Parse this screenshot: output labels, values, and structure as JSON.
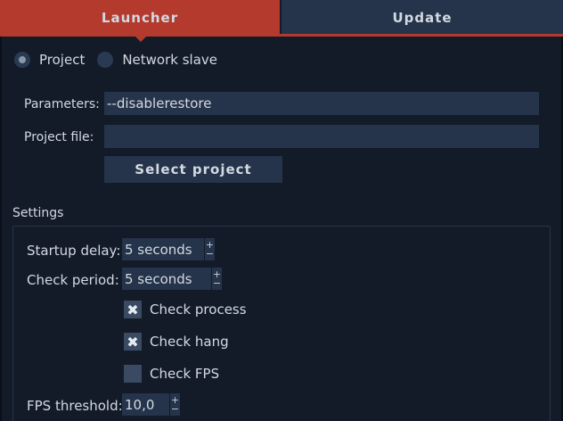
{
  "tabs": {
    "launcher": "Launcher",
    "update": "Update"
  },
  "mode": {
    "project_label": "Project",
    "network_slave_label": "Network slave",
    "selected": "Project"
  },
  "parameters": {
    "label": "Parameters:",
    "value": "--disablerestore"
  },
  "project_file": {
    "label": "Project file:",
    "value": ""
  },
  "select_project_label": "Select project",
  "settings": {
    "title": "Settings",
    "startup_delay": {
      "label": "Startup delay:",
      "value": "5 seconds"
    },
    "check_period": {
      "label": "Check period:",
      "value": "5 seconds"
    },
    "check_process": {
      "label": "Check process",
      "checked": true
    },
    "check_hang": {
      "label": "Check hang",
      "checked": true
    },
    "check_fps": {
      "label": "Check FPS",
      "checked": false
    },
    "fps_threshold": {
      "label": "FPS threshold:",
      "value": "10,0"
    }
  },
  "spin_glyphs": {
    "up": "+",
    "down": "−"
  },
  "check_glyph": "✖",
  "colors": {
    "accent": "#b33a2c",
    "background": "#131b29",
    "control": "#25344a"
  }
}
